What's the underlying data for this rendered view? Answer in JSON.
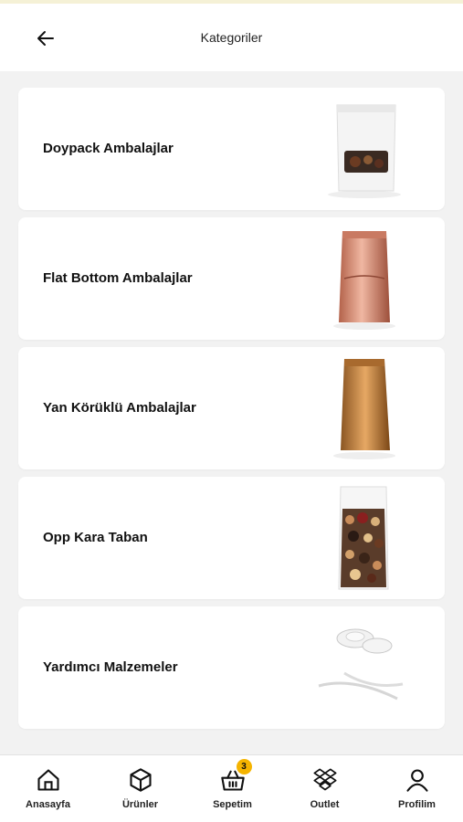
{
  "header": {
    "title": "Kategoriler",
    "back_icon": "arrow-left-icon"
  },
  "categories": [
    {
      "label": "Doypack Ambalajlar",
      "image": "doypack-bag-image"
    },
    {
      "label": "Flat Bottom Ambalajlar",
      "image": "flat-bottom-bag-image"
    },
    {
      "label": "Yan Körüklü Ambalajlar",
      "image": "side-gusset-bag-image"
    },
    {
      "label": "Opp Kara Taban",
      "image": "opp-bag-image"
    },
    {
      "label": "Yardımcı Malzemeler",
      "image": "accessories-image"
    }
  ],
  "tabbar": {
    "home": {
      "label": "Anasayfa",
      "icon": "home-icon"
    },
    "products": {
      "label": "Ürünler",
      "icon": "box-icon"
    },
    "cart": {
      "label": "Sepetim",
      "icon": "basket-icon",
      "badge": "3"
    },
    "outlet": {
      "label": "Outlet",
      "icon": "dropbox-icon"
    },
    "profile": {
      "label": "Profilim",
      "icon": "user-icon"
    }
  },
  "colors": {
    "accent": "#f5b400",
    "background": "#f2f2f2",
    "card": "#ffffff"
  }
}
